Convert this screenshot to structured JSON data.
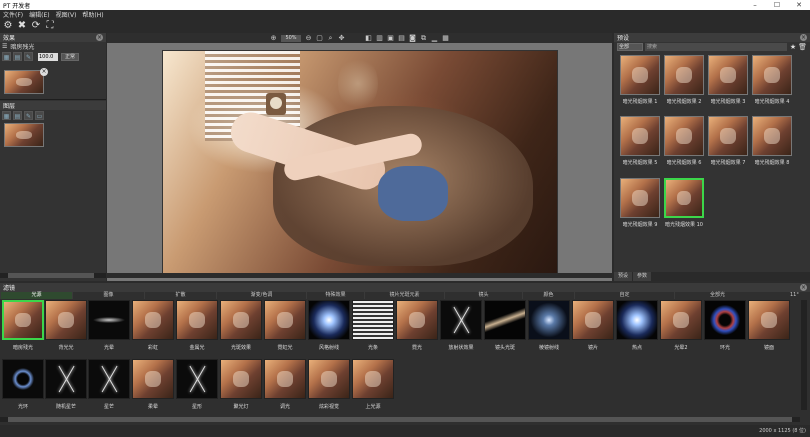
{
  "window": {
    "title": "PT 开发者",
    "min": "–",
    "max": "☐",
    "close": "✕"
  },
  "menu": [
    "文件(F)",
    "编辑(E)",
    "视图(V)",
    "帮助(H)"
  ],
  "effects_panel": {
    "title": "效果",
    "layer_name": "暗房残光",
    "opacity_value": "100.0",
    "normal_button": "正常"
  },
  "mask_panel": {
    "title": "图层"
  },
  "center": {
    "zoom": "50%"
  },
  "presets_panel": {
    "title": "预设",
    "category": "全部",
    "search_placeholder": "搜索",
    "items": [
      {
        "label": "暗光残烟效果 1"
      },
      {
        "label": "暗光残烟效果 2"
      },
      {
        "label": "暗光残烟效果 3"
      },
      {
        "label": "暗光残烟效果 4"
      },
      {
        "label": "暗光残烟效果 5"
      },
      {
        "label": "暗光残烟效果 6"
      },
      {
        "label": "暗光残烟效果 7"
      },
      {
        "label": "暗光残烟效果 8"
      },
      {
        "label": "暗光残烟效果 9"
      },
      {
        "label": "暗光残烟效果 10"
      }
    ],
    "tabs": [
      "预设",
      "参数"
    ]
  },
  "filters_panel": {
    "title": "滤镜",
    "categories": [
      "光源",
      "图像",
      "扩散",
      "渐变/色调",
      "特殊效果",
      "镜片光斑元素",
      "镜头",
      "颜色",
      "自定",
      "全部光"
    ],
    "page_count": "11°",
    "row1": [
      "暗房残光",
      "背光光",
      "光晕",
      "彩虹",
      "金属光",
      "光斑效果",
      "霓虹光",
      "风格射线",
      "光条",
      "霓光",
      "放射状效果",
      "镜头光斑",
      "棱镜射线",
      "镜片",
      "热点",
      "光晕2",
      "环光",
      "镜面"
    ],
    "row2": [
      "光环",
      "随机星芒",
      "星芒",
      "柔晕",
      "星形",
      "聚光灯",
      "调光",
      "炫彩视觉",
      "上光源"
    ]
  },
  "status": {
    "dimensions": "2000 x 1125 (8 位)"
  }
}
